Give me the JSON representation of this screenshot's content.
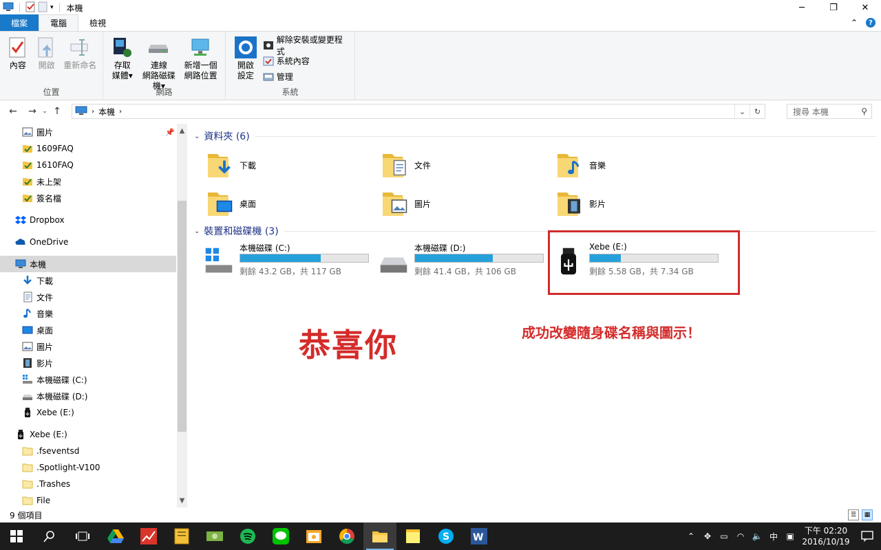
{
  "window": {
    "title": "本機"
  },
  "ribbon_tabs": [
    "檔案",
    "電腦",
    "檢視"
  ],
  "ribbon": {
    "location_group": {
      "label": "位置",
      "buttons": [
        "內容",
        "開啟",
        "重新命名"
      ]
    },
    "network_group": {
      "label": "網路",
      "buttons": [
        {
          "line1": "存取",
          "line2": "媒體"
        },
        {
          "line1": "連線",
          "line2": "網路磁碟機"
        },
        {
          "line1": "新增一個",
          "line2": "網路位置"
        }
      ]
    },
    "system_group": {
      "label": "系統",
      "open_settings": {
        "line1": "開啟",
        "line2": "設定"
      },
      "small_buttons": [
        "解除安裝或變更程式",
        "系統內容",
        "管理"
      ]
    }
  },
  "address": {
    "crumb": "本機",
    "search_placeholder": "搜尋 本機"
  },
  "nav_pane": {
    "items": [
      {
        "label": "圖片",
        "icon": "pictures-icon",
        "indent": 1,
        "pinned": true
      },
      {
        "label": "1609FAQ",
        "icon": "folder-check-icon",
        "indent": 1
      },
      {
        "label": "1610FAQ",
        "icon": "folder-check-icon",
        "indent": 1
      },
      {
        "label": "未上架",
        "icon": "folder-check-icon",
        "indent": 1
      },
      {
        "label": "簽名檔",
        "icon": "folder-check-icon",
        "indent": 1
      },
      {
        "label": "Dropbox",
        "icon": "dropbox-icon",
        "indent": 0
      },
      {
        "label": "OneDrive",
        "icon": "onedrive-icon",
        "indent": 0
      },
      {
        "label": "本機",
        "icon": "computer-icon",
        "indent": 0,
        "selected": true
      },
      {
        "label": "下載",
        "icon": "download-icon",
        "indent": 1
      },
      {
        "label": "文件",
        "icon": "documents-icon",
        "indent": 1
      },
      {
        "label": "音樂",
        "icon": "music-icon",
        "indent": 1
      },
      {
        "label": "桌面",
        "icon": "desktop-icon",
        "indent": 1
      },
      {
        "label": "圖片",
        "icon": "pictures-icon",
        "indent": 1
      },
      {
        "label": "影片",
        "icon": "videos-icon",
        "indent": 1
      },
      {
        "label": "本機磁碟 (C:)",
        "icon": "windows-drive-icon",
        "indent": 1
      },
      {
        "label": "本機磁碟 (D:)",
        "icon": "drive-icon",
        "indent": 1
      },
      {
        "label": "Xebe (E:)",
        "icon": "usb-icon",
        "indent": 1
      },
      {
        "label": "Xebe (E:)",
        "icon": "usb-icon",
        "indent": 0
      },
      {
        "label": ".fseventsd",
        "icon": "folder-icon",
        "indent": 1
      },
      {
        "label": ".Spotlight-V100",
        "icon": "folder-icon",
        "indent": 1
      },
      {
        "label": ".Trashes",
        "icon": "folder-icon",
        "indent": 1
      },
      {
        "label": "File",
        "icon": "folder-icon",
        "indent": 1
      }
    ]
  },
  "content": {
    "folders_header": "資料夾 (6)",
    "folders": [
      {
        "label": "下載",
        "icon": "download-icon"
      },
      {
        "label": "文件",
        "icon": "documents-icon"
      },
      {
        "label": "音樂",
        "icon": "music-icon"
      },
      {
        "label": "桌面",
        "icon": "desktop-icon"
      },
      {
        "label": "圖片",
        "icon": "pictures-icon"
      },
      {
        "label": "影片",
        "icon": "videos-icon"
      }
    ],
    "drives_header": "裝置和磁碟機 (3)",
    "drives": [
      {
        "label": "本機磁碟 (C:)",
        "free": "剩餘 43.2 GB，共 117 GB",
        "used_fraction": 0.63,
        "icon": "windows-drive-icon"
      },
      {
        "label": "本機磁碟 (D:)",
        "free": "剩餘 41.4 GB，共 106 GB",
        "used_fraction": 0.61,
        "icon": "drive-icon"
      },
      {
        "label": "Xebe (E:)",
        "free": "剩餘 5.58 GB，共 7.34 GB",
        "used_fraction": 0.24,
        "icon": "usb-icon"
      }
    ],
    "congrats": "恭喜你",
    "success_message": "成功改變隨身碟名稱與圖示！"
  },
  "status": {
    "items_count": "9 個項目"
  },
  "taskbar": {
    "clock_period_time": "下午 02:20",
    "clock_date": "2016/10/19",
    "ime": "中"
  },
  "colors": {
    "accent": "#1979ca",
    "progress": "#26a0da",
    "annotation_red": "#d42b2b"
  }
}
